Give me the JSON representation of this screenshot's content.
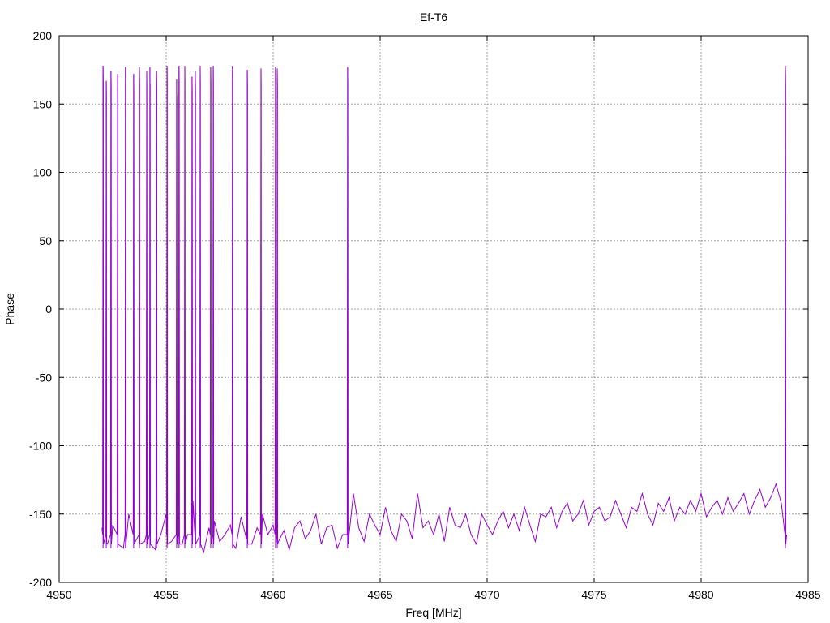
{
  "chart_data": {
    "type": "line",
    "title": "Ef-T6",
    "xlabel": "Freq [MHz]",
    "ylabel": "Phase",
    "xlim": [
      4950,
      4985
    ],
    "ylim": [
      -200,
      200
    ],
    "xticks": [
      4950,
      4955,
      4960,
      4965,
      4970,
      4975,
      4980,
      4985
    ],
    "yticks": [
      -200,
      -150,
      -100,
      -50,
      0,
      50,
      100,
      150,
      200
    ],
    "grid": true,
    "line_color": "#9400d3",
    "series": [
      {
        "name": "Phase",
        "x_start": 4952.0,
        "x_step": 0.25,
        "baseline": [
          -160,
          -172,
          -158,
          -165,
          -175,
          -150,
          -168,
          -162,
          -170,
          -158,
          -176,
          -165,
          -150,
          -170,
          -160,
          -172,
          -165,
          -140,
          -168,
          -178,
          -160,
          -155,
          -170,
          -165,
          -158,
          -175,
          -152,
          -168,
          -172,
          -160,
          -150,
          -165,
          -158,
          -170,
          -162,
          -176,
          -160,
          -155,
          -168,
          -162,
          -150,
          -172,
          -160,
          -158,
          -175,
          -165,
          -155,
          -135,
          -160,
          -170,
          -150,
          -158,
          -165,
          -145,
          -162,
          -170,
          -150,
          -155,
          -168,
          -135,
          -160,
          -155,
          -165,
          -150,
          -170,
          -145,
          -158,
          -160,
          -150,
          -165,
          -172,
          -150,
          -158,
          -165,
          -155,
          -148,
          -160,
          -150,
          -162,
          -145,
          -158,
          -170,
          -150,
          -152,
          -145,
          -160,
          -148,
          -142,
          -155,
          -150,
          -140,
          -158,
          -148,
          -145,
          -155,
          -152,
          -140,
          -150,
          -160,
          -145,
          -148,
          -135,
          -150,
          -158,
          -142,
          -148,
          -138,
          -155,
          -145,
          -150,
          -140,
          -148,
          -135,
          -152,
          -145,
          -140,
          -150,
          -138,
          -148,
          -142,
          -135,
          -150,
          -140,
          -132,
          -145,
          -138,
          -128,
          -142,
          -165
        ],
        "wraps": [
          {
            "x": 4952.05,
            "peak": 178
          },
          {
            "x": 4952.2,
            "peak": 167
          },
          {
            "x": 4952.42,
            "peak": 174
          },
          {
            "x": 4952.73,
            "peak": 172
          },
          {
            "x": 4953.1,
            "peak": 177
          },
          {
            "x": 4953.48,
            "peak": 172
          },
          {
            "x": 4953.75,
            "peak": 177
          },
          {
            "x": 4954.09,
            "peak": 174
          },
          {
            "x": 4954.24,
            "peak": 177
          },
          {
            "x": 4954.55,
            "peak": 174
          },
          {
            "x": 4955.04,
            "peak": 178
          },
          {
            "x": 4955.49,
            "peak": 168
          },
          {
            "x": 4955.6,
            "peak": 178
          },
          {
            "x": 4955.87,
            "peak": 178
          },
          {
            "x": 4956.21,
            "peak": 170
          },
          {
            "x": 4956.36,
            "peak": 174
          },
          {
            "x": 4956.59,
            "peak": 178
          },
          {
            "x": 4957.08,
            "peak": 177
          },
          {
            "x": 4957.2,
            "peak": 178
          },
          {
            "x": 4958.1,
            "peak": 178
          },
          {
            "x": 4958.79,
            "peak": 175
          },
          {
            "x": 4959.43,
            "peak": 176
          },
          {
            "x": 4960.11,
            "peak": 177
          },
          {
            "x": 4960.19,
            "peak": 176
          },
          {
            "x": 4963.48,
            "peak": 177
          },
          {
            "x": 4983.94,
            "peak": 178
          }
        ]
      }
    ]
  }
}
